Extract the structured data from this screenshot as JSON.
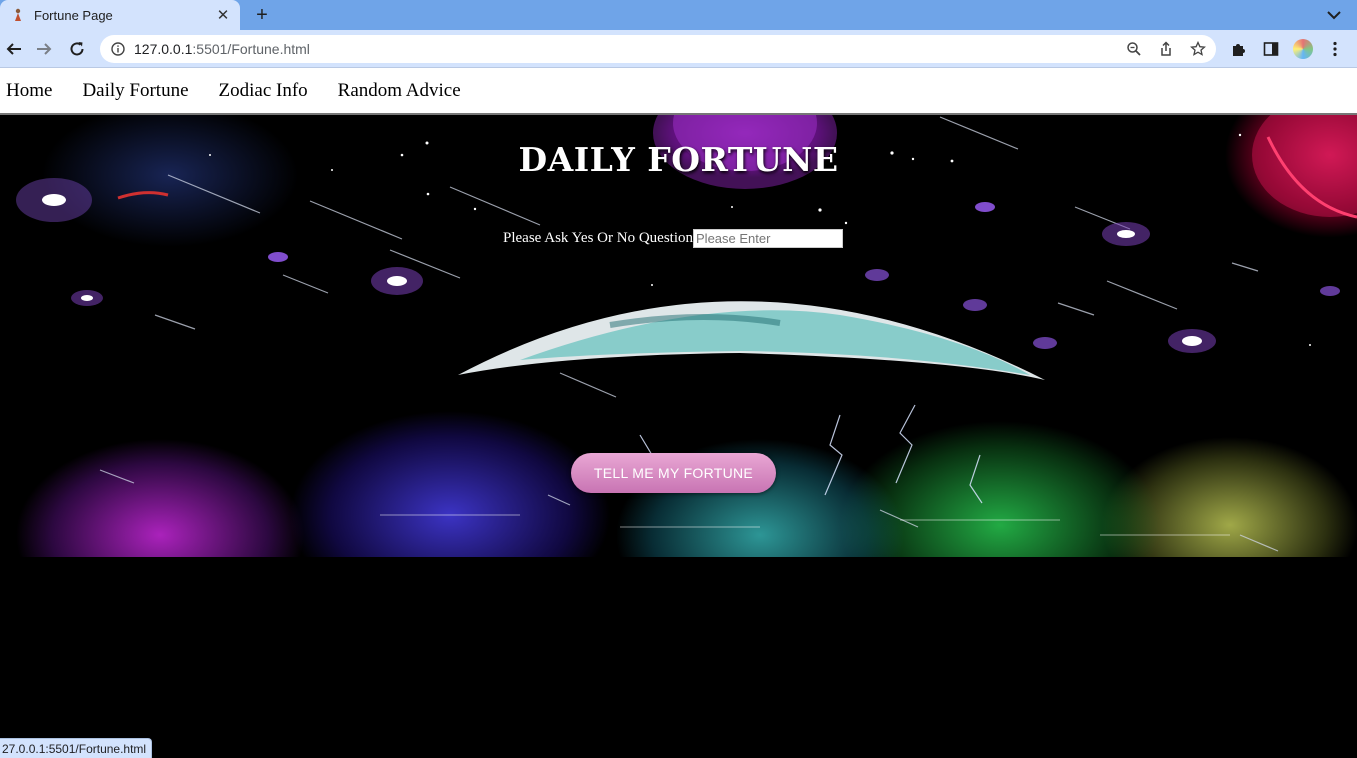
{
  "browser": {
    "tab_title": "Fortune Page",
    "new_tab_symbol": "+",
    "close_symbol": "✕",
    "url_host": "127.0.0.1",
    "url_rest": ":5501/Fortune.html",
    "status_text": "27.0.0.1:5501/Fortune.html",
    "icons": [
      "back-icon",
      "forward-icon",
      "reload-icon",
      "site-info-icon",
      "zoom-icon",
      "share-icon",
      "bookmark-star-icon",
      "extensions-icon",
      "side-panel-icon",
      "profile-avatar",
      "more-menu-icon",
      "tab-list-icon"
    ]
  },
  "nav": {
    "items": [
      {
        "label": "Home"
      },
      {
        "label": "Daily Fortune"
      },
      {
        "label": "Zodiac Info"
      },
      {
        "label": "Random Advice"
      }
    ]
  },
  "hero": {
    "title": "DAILY FORTUNE",
    "question_label": "Please Ask Yes Or No Question",
    "input_placeholder": "Please Enter",
    "button_label": "TELL ME MY FORTUNE"
  },
  "colors": {
    "chrome_tab_bar": "#6fa4e8",
    "chrome_toolbar": "#d3e3fd",
    "button_top": "#e9a7d4",
    "button_bottom": "#c874b3",
    "page_background": "#000000"
  }
}
